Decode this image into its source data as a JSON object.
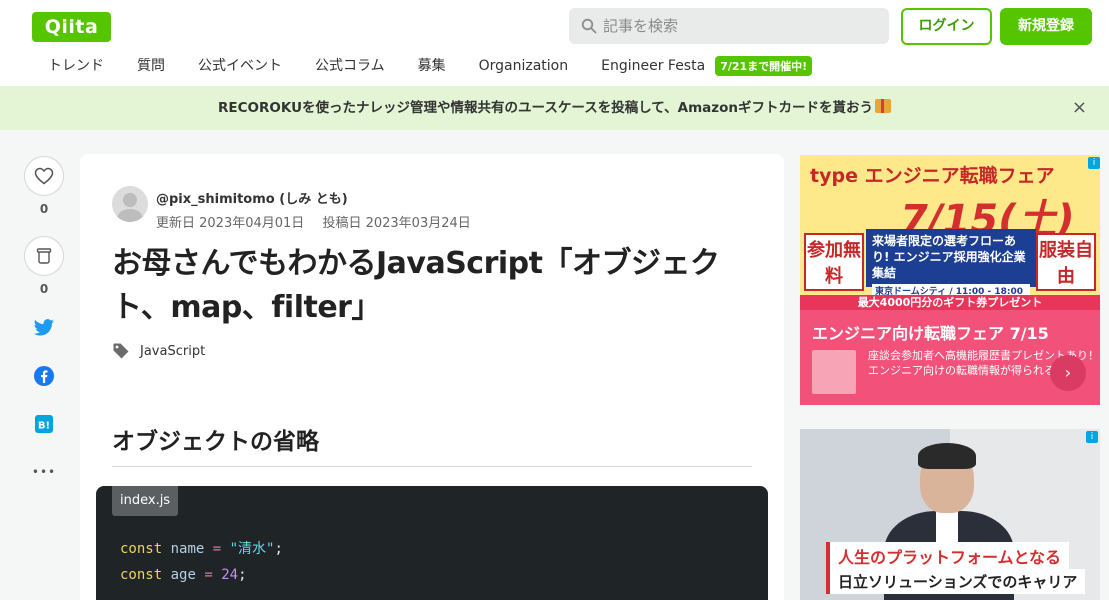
{
  "header": {
    "logo": "Qiita",
    "search_placeholder": "記事を検索",
    "login_label": "ログイン",
    "signup_label": "新規登録",
    "nav": [
      "トレンド",
      "質問",
      "公式イベント",
      "公式コラム",
      "募集",
      "Organization",
      "Engineer Festa"
    ],
    "nav_badge": "7/21まで開催中!"
  },
  "announcement": {
    "text": "RECOROKUを使ったナレッジ管理や情報共有のユースケースを投稿して、Amazonギフトカードを貰おう",
    "close": "×"
  },
  "side_actions": {
    "like_count": "0",
    "stock_count": "0",
    "more": "•••"
  },
  "article": {
    "author": "@pix_shimitomo (しみ とも)",
    "updated": "更新日 2023年04月01日",
    "posted": "投稿日 2023年03月24日",
    "title": "お母さんでもわかるJavaScript「オブジェクト、map、filter」",
    "tag": "JavaScript",
    "section_heading": "オブジェクトの省略",
    "code": {
      "filename": "index.js",
      "lines": [
        {
          "kw": "const",
          "var": "name",
          "op": "=",
          "val": "\"清水\"",
          "end": ";"
        },
        {
          "kw": "const",
          "var": "age",
          "op": "=",
          "val": "24",
          "end": ";"
        }
      ]
    }
  },
  "ads": {
    "ad1": {
      "brand": "type エンジニア転職フェア",
      "date": "7/15(土)",
      "left_box": "参加無料",
      "right_box": "服装自由",
      "blue_text": "来場者限定の選考フローあり! エンジニア採用強化企業集結",
      "location": "東京ドームシティ / 11:00 - 18:00",
      "strip": "最大4000円分のギフト券プレゼント",
      "bottom_title": "エンジニア向け転職フェア 7/15",
      "bottom_desc": "座談会参加者へ高機能履歴書プレゼントあり！エンジニア向けの転職情報が得られる"
    },
    "ad2": {
      "caption1": "人生のプラットフォームとなる",
      "caption2": "日立ソリューションズでのキャリア"
    }
  },
  "colors": {
    "brand_green": "#55c500",
    "announce_bg": "#e3f5d5",
    "code_bg": "#1f2426"
  }
}
